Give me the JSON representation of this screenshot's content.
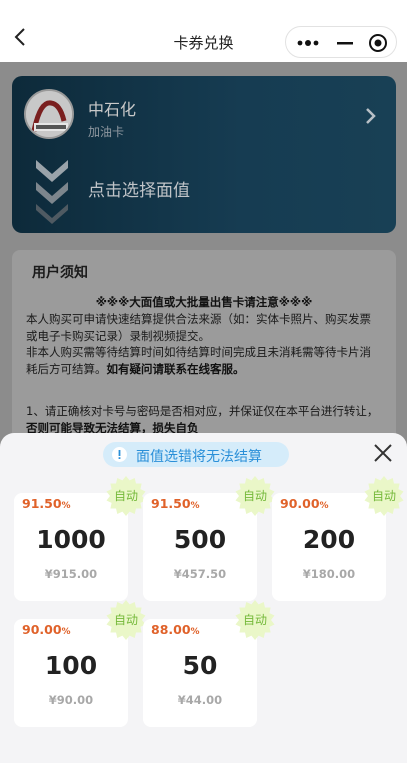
{
  "nav": {
    "title": "卡券兑换"
  },
  "hero": {
    "brand": "中石化",
    "sub": "加油卡",
    "choose": "点击选择面值"
  },
  "notice": {
    "title": "用户须知",
    "warn": "※※※大面值或大批量出售卡请注意※※※",
    "p1": "本人购买可申请快速结算提供合法来源（如：实体卡照片、购买发票或电子卡购买记录）录制视频提交。",
    "p2a": "非本人购买需等待结算时间如待结算时间完成且未消耗需等待卡片消耗后方可结算。",
    "p2b": "如有疑问请联系在线客服。",
    "p3a": "1、请正确核对卡号与密码是否相对应，并保证仅在本平台进行转让，",
    "p3b": "否则可能导致无法结算，损失自负"
  },
  "sheet": {
    "tip": "面值选错将无法结算",
    "auto": "自动",
    "options": [
      {
        "disc": "91.50",
        "amt": "1000",
        "price": "¥915.00"
      },
      {
        "disc": "91.50",
        "amt": "500",
        "price": "¥457.50"
      },
      {
        "disc": "90.00",
        "amt": "200",
        "price": "¥180.00"
      },
      {
        "disc": "90.00",
        "amt": "100",
        "price": "¥90.00"
      },
      {
        "disc": "88.00",
        "amt": "50",
        "price": "¥44.00"
      }
    ],
    "pct": "%"
  },
  "colors": {
    "accent": "#e0622a",
    "tip": "#2a8fd8",
    "auto": "#75b93a"
  }
}
